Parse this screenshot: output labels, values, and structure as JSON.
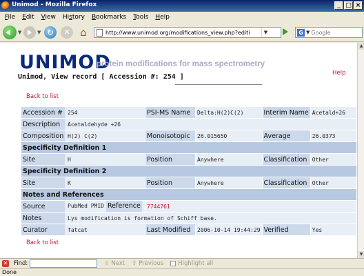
{
  "window": {
    "title": "Unimod - Mozilla Firefox",
    "controls": [
      "_",
      "□",
      "×"
    ]
  },
  "menubar": {
    "items": [
      {
        "first": "F",
        "rest": "ile"
      },
      {
        "first": "E",
        "rest": "dit"
      },
      {
        "first": "V",
        "rest": "iew"
      },
      {
        "first": "",
        "rest": "Hi",
        "mid": "s",
        "tail": "tory"
      },
      {
        "first": "B",
        "rest": "ookmarks"
      },
      {
        "first": "T",
        "rest": "ools"
      },
      {
        "first": "H",
        "rest": "elp"
      }
    ]
  },
  "navbar": {
    "url": "http://www.unimod.org/modifications_view.php?editi",
    "search_placeholder": "Google"
  },
  "page": {
    "logo": "UNIMOD",
    "tagline": "protein modifications for mass spectrometry",
    "help": "Help",
    "title": "Unimod, View record [ Accession #: 254 ]",
    "back_to_list": "Back to list"
  },
  "record": {
    "accession_label": "Accession #",
    "accession": "254",
    "psims_label": "PSI-MS Name",
    "psims": "Delta:H(2)C(2)",
    "interim_label": "Interim Name",
    "interim": "Acetald+26",
    "description_label": "Description",
    "description": "Acetaldehyde +26",
    "composition_label": "Composition",
    "composition": "H(2) C(2)",
    "mono_label": "Monoisotopic",
    "mono": "26.015650",
    "average_label": "Average",
    "average": "26.0373",
    "spec1_title": "Specificity Definition 1",
    "spec1": {
      "site_label": "Site",
      "site": "H",
      "position_label": "Position",
      "position": "Anywhere",
      "class_label": "Classification",
      "class": "Other"
    },
    "spec2_title": "Specificity Definition 2",
    "spec2": {
      "site_label": "Site",
      "site": "K",
      "position_label": "Position",
      "position": "Anywhere",
      "class_label": "Classification",
      "class": "Other"
    },
    "notes_title": "Notes and References",
    "source_label": "Source",
    "source": "PubMed PMID",
    "reference_label": "Reference",
    "reference": "7744761",
    "notes_label": "Notes",
    "notes": "Lys modification is formation of Schiff base.",
    "curator_label": "Curator",
    "curator": "fatcat",
    "modified_label": "Last Modified",
    "modified": "2006-10-14 19:44:29",
    "verified_label": "Verified",
    "verified": "Yes"
  },
  "findbar": {
    "label": "Find:",
    "next": "Next",
    "previous": "Previous",
    "highlight": "Highlight all"
  },
  "status": "Done",
  "colors": {
    "accent_red": "#c8102e",
    "logo_blue": "#0b2a7a",
    "label_bg": "#ccd9ea",
    "value_bg": "#e8eef6"
  }
}
